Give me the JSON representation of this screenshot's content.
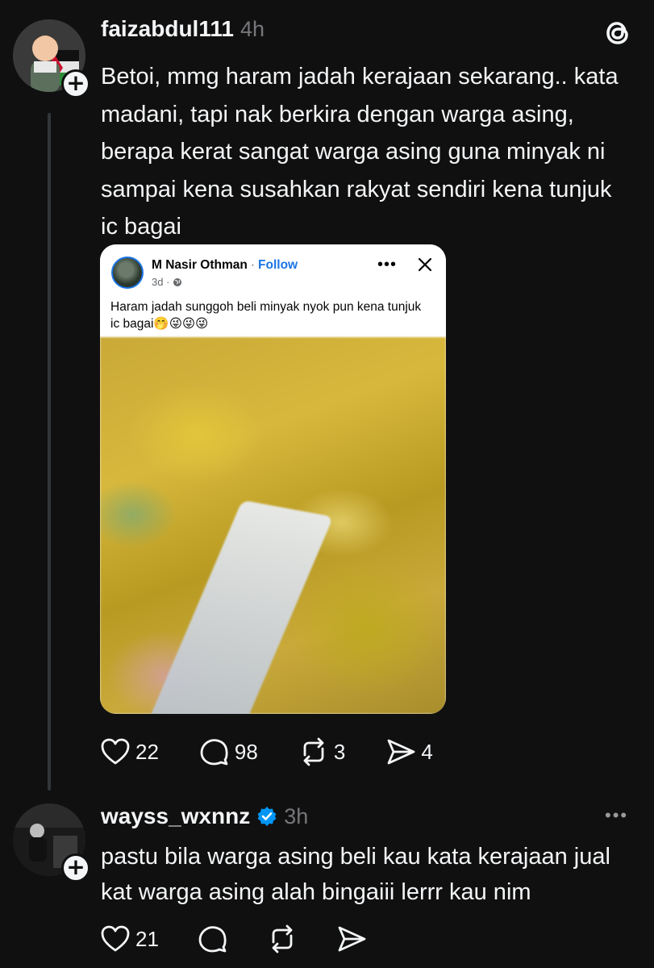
{
  "post": {
    "username": "faizabdul111",
    "time": "4h",
    "text": "Betoi, mmg haram jadah kerajaan sekarang.. kata madani, tapi nak berkira dengan warga asing, berapa kerat sangat warga asing guna minyak ni sampai kena susahkan rakyat sendiri kena tunjuk ic bagai",
    "embedded": {
      "author": "M Nasir Othman",
      "separator": "·",
      "follow_label": "Follow",
      "age": "3d ·",
      "caption": "Haram jadah sunggoh beli minyak nyok pun kena tunjuk ic bagai🤭😜😜😜"
    },
    "stats": {
      "likes": "22",
      "replies": "98",
      "reposts": "3",
      "shares": "4"
    }
  },
  "reply": {
    "username": "wayss_wxnnz",
    "time": "3h",
    "text": "pastu bila warga asing beli kau kata kerajaan jual kat warga asing  alah bingaiii lerrr kau nim",
    "stats": {
      "likes": "21"
    }
  },
  "colors": {
    "background": "#101010",
    "text": "#f3f5f7",
    "muted": "#77777b",
    "verified": "#0095f6",
    "facebook_blue": "#1b74e4"
  },
  "icons": [
    "threads-logo-icon",
    "heart-icon",
    "comment-icon",
    "repost-icon",
    "share-icon",
    "verified-icon",
    "more-icon",
    "close-icon",
    "globe-icon",
    "plus-icon"
  ]
}
